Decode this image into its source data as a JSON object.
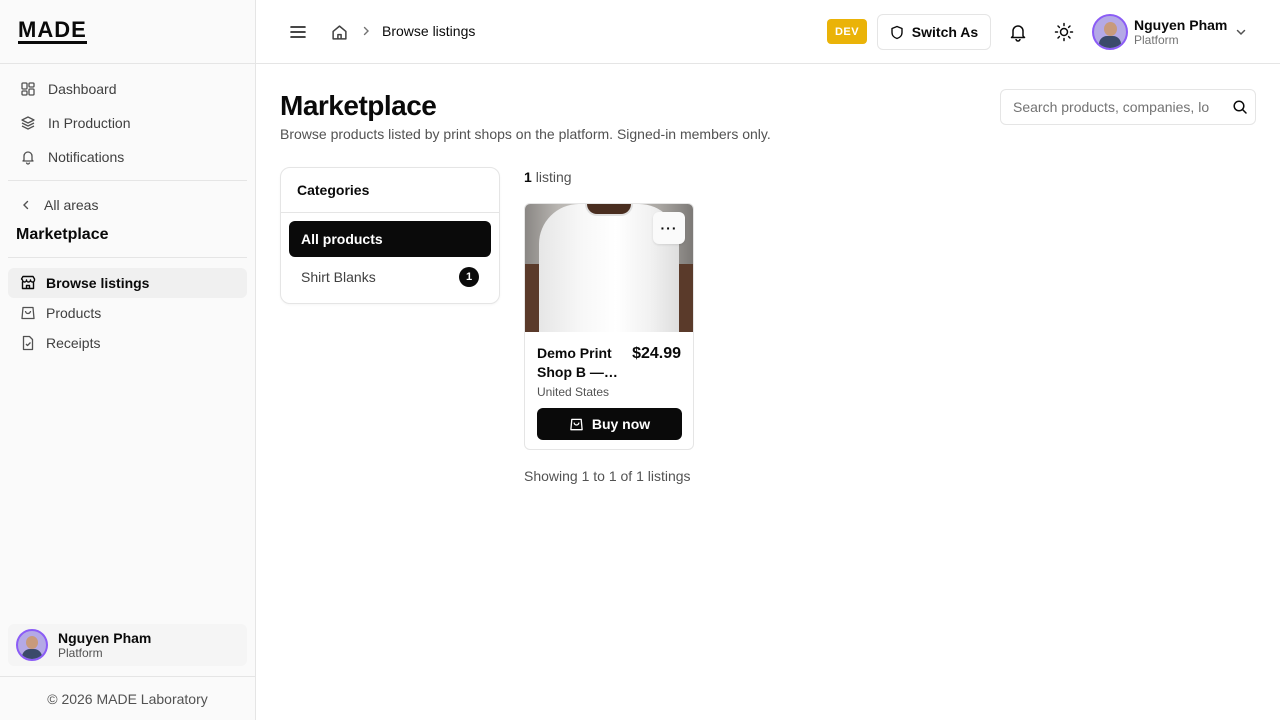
{
  "brand": {
    "logo": "MADE"
  },
  "sidebar": {
    "items": [
      {
        "label": "Dashboard",
        "icon": "dashboard-icon"
      },
      {
        "label": "In Production",
        "icon": "layers-icon"
      },
      {
        "label": "Notifications",
        "icon": "bell-icon"
      }
    ],
    "back_label": "All areas",
    "area_title": "Marketplace",
    "sub_items": [
      {
        "label": "Browse listings",
        "icon": "store-icon",
        "active": true
      },
      {
        "label": "Products",
        "icon": "shopping-bag-icon"
      },
      {
        "label": "Receipts",
        "icon": "receipt-icon"
      }
    ],
    "user": {
      "name": "Nguyen Pham",
      "role": "Platform"
    },
    "footer": "© 2026 MADE Laboratory"
  },
  "header": {
    "breadcrumb_current": "Browse listings",
    "env_badge": "DEV",
    "switch_label": "Switch As",
    "user": {
      "name": "Nguyen Pham",
      "role": "Platform"
    }
  },
  "main": {
    "title": "Marketplace",
    "subtitle": "Browse products listed by print shops on the platform. Signed-in members only.",
    "search_placeholder": "Search products, companies, lo",
    "categories": {
      "title": "Categories",
      "items": [
        {
          "label": "All products",
          "active": true
        },
        {
          "label": "Shirt Blanks",
          "count": "1"
        }
      ]
    },
    "listing_count": {
      "number": "1",
      "label": "listing"
    },
    "listings": [
      {
        "title": "Demo Print Shop B — White T-Shirt",
        "price": "$24.99",
        "location": "United States",
        "buy_label": "Buy now",
        "more_label": "···"
      }
    ],
    "pagination_text": "Showing 1 to 1 of 1 listings"
  },
  "colors": {
    "accent": "#0a0a0a",
    "dev_badge": "#eab308",
    "avatar_ring": "#8b5cf6"
  }
}
